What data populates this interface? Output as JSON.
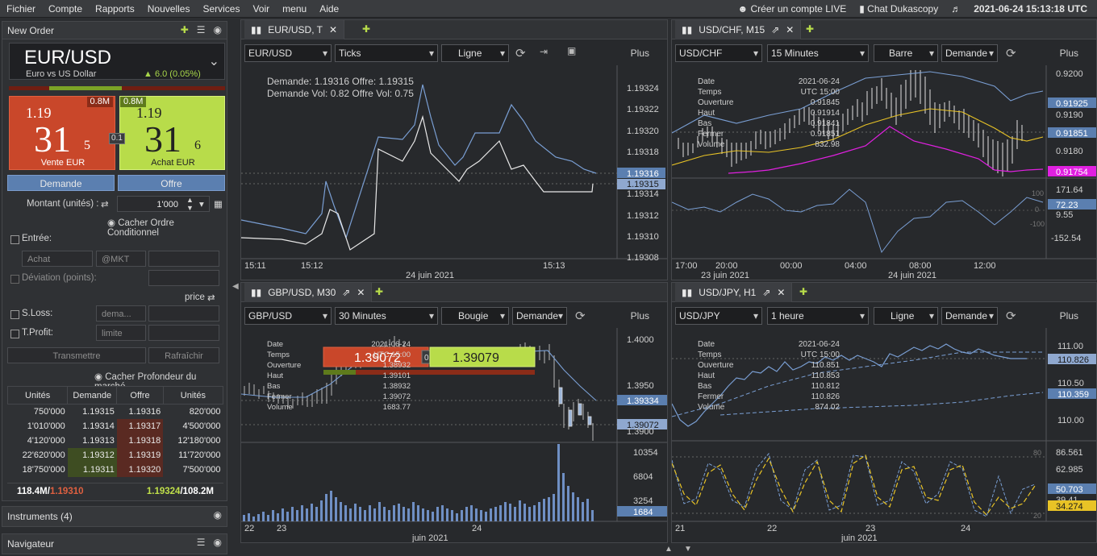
{
  "menu": {
    "items": [
      "Fichier",
      "Compte",
      "Rapports",
      "Nouvelles",
      "Services",
      "Voir",
      "menu",
      "Aide"
    ],
    "create_live": "Créer un compte LIVE",
    "chat": "Chat Dukascopy",
    "clock": "2021-06-24 15:13:18",
    "tz": "UTC"
  },
  "new_order": {
    "title": "New Order",
    "pair": "EUR/USD",
    "desc": "Euro vs US Dollar",
    "change": "6.0 (0.05%)",
    "sell": {
      "liq": "0.8M",
      "small": "1.19",
      "big": "31",
      "sup": "5",
      "label": "Vente EUR"
    },
    "buy": {
      "liq": "0.8M",
      "small": "1.19",
      "big": "31",
      "sup": "6",
      "label": "Achat EUR"
    },
    "spread": "0.1",
    "demande_btn": "Demande",
    "offre_btn": "Offre",
    "amount_label": "Montant (unités) :",
    "amount_value": "1'000",
    "hide_cond": "Cacher Ordre Conditionnel",
    "entry_label": "Entrée:",
    "achat_ph": "Achat",
    "mkt_ph": "@MKT",
    "deviation_label": "Déviation (points):",
    "price_label": "price",
    "sloss_label": "S.Loss:",
    "sloss_ph": "dema...",
    "tprofit_label": "T.Profit:",
    "tprofit_ph": "limite",
    "transmit": "Transmettre",
    "refresh": "Rafraîchir",
    "hide_depth": "Cacher Profondeur du marché"
  },
  "order_book": {
    "headers": [
      "Unités",
      "Demande",
      "Offre",
      "Unités"
    ],
    "rows": [
      [
        "750'000",
        "1.19315",
        "1.19316",
        "820'000"
      ],
      [
        "1'010'000",
        "1.19314",
        "1.19317",
        "4'500'000"
      ],
      [
        "4'120'000",
        "1.19313",
        "1.19318",
        "12'180'000"
      ],
      [
        "22'620'000",
        "1.19312",
        "1.19319",
        "11'720'000"
      ],
      [
        "18'750'000",
        "1.19311",
        "1.19320",
        "7'500'000"
      ]
    ],
    "foot_left_vol": "118.4M",
    "foot_left_price": "1.19310",
    "foot_right_price": "1.19324",
    "foot_right_vol": "108.2M"
  },
  "instruments_panel": "Instruments (4)",
  "navigator_panel": "Navigateur",
  "colors": {
    "sell": "#c9472a",
    "buy": "#b8dc4a",
    "accent": "#5b7fb0"
  },
  "charts": {
    "c1": {
      "tab": "EUR/USD, T",
      "instrument": "EUR/USD",
      "period": "Ticks",
      "type": "Ligne",
      "plus": "Plus",
      "info1": "Demande: 1.19316  Offre: 1.19315",
      "info2": "Demande Vol: 0.82  Offre Vol: 0.75",
      "yticks": [
        "1.19324",
        "1.19322",
        "1.19320",
        "1.19318",
        "1.19316",
        "1.19315",
        "1.19314",
        "1.19312",
        "1.19310",
        "1.19308"
      ],
      "xticks": [
        "15:11",
        "15:12",
        "15:13"
      ],
      "date": "24 juin 2021"
    },
    "c2": {
      "tab": "USD/CHF, M15",
      "instrument": "USD/CHF",
      "period": "15 Minutes",
      "type": "Barre",
      "side": "Demande",
      "plus": "Plus",
      "info_labels": [
        "Date",
        "Temps",
        "Ouverture",
        "Haut",
        "Bas",
        "Fermer",
        "Volume"
      ],
      "info_values": [
        "2021-06-24",
        "UTC 15:00",
        "0.91845",
        "0.91914",
        "0.91841",
        "0.91851",
        "832.98"
      ],
      "yticks": [
        "0.9200",
        "0.91925",
        "0.9190",
        "0.91851",
        "0.9180",
        "0.91754"
      ],
      "osc_ticks": [
        "171.64",
        "72.23",
        "9.55",
        "-152.54"
      ],
      "osc_small": [
        "100",
        "0",
        "-100"
      ],
      "xticks": [
        "17:00",
        "20:00",
        "00:00",
        "04:00",
        "08:00",
        "12:00"
      ],
      "dates": [
        "23 juin 2021",
        "24 juin 2021"
      ]
    },
    "c3": {
      "tab": "GBP/USD, M30",
      "instrument": "GBP/USD",
      "period": "30 Minutes",
      "type": "Bougie",
      "side": "Demande",
      "plus": "Plus",
      "info_labels": [
        "Date",
        "Temps",
        "Ouverture",
        "Haut",
        "Bas",
        "Fermer",
        "Volume"
      ],
      "info_values": [
        "2021-06-24",
        "UTC 15:00",
        "1.38932",
        "1.39101",
        "1.38932",
        "1.39072",
        "1683.77"
      ],
      "sell_price": "1.39072",
      "buy_price": "1.39079",
      "spread": "0.7",
      "yticks": [
        "1.4000",
        "1.3950",
        "1.39334",
        "1.39072",
        "1.3900"
      ],
      "vol_ticks": [
        "10354",
        "6804",
        "3254",
        "1684"
      ],
      "xticks": [
        "22",
        "23",
        "24"
      ],
      "date": "juin 2021"
    },
    "c4": {
      "tab": "USD/JPY, H1",
      "instrument": "USD/JPY",
      "period": "1 heure",
      "type": "Ligne",
      "side": "Demande",
      "plus": "Plus",
      "info_labels": [
        "Date",
        "Temps",
        "Ouverture",
        "Haut",
        "Bas",
        "Fermer",
        "Volume"
      ],
      "info_values": [
        "2021-06-24",
        "UTC 15:00",
        "110.851",
        "110.853",
        "110.812",
        "110.826",
        "874.02"
      ],
      "yticks": [
        "111.00",
        "110.826",
        "110.50",
        "110.359",
        "110.00"
      ],
      "osc_ticks": [
        "86.561",
        "62.985",
        "50.703",
        "39.41",
        "34.274"
      ],
      "osc_small": [
        "80",
        "20"
      ],
      "xticks": [
        "21",
        "22",
        "23",
        "24"
      ],
      "date": "juin 2021"
    }
  }
}
